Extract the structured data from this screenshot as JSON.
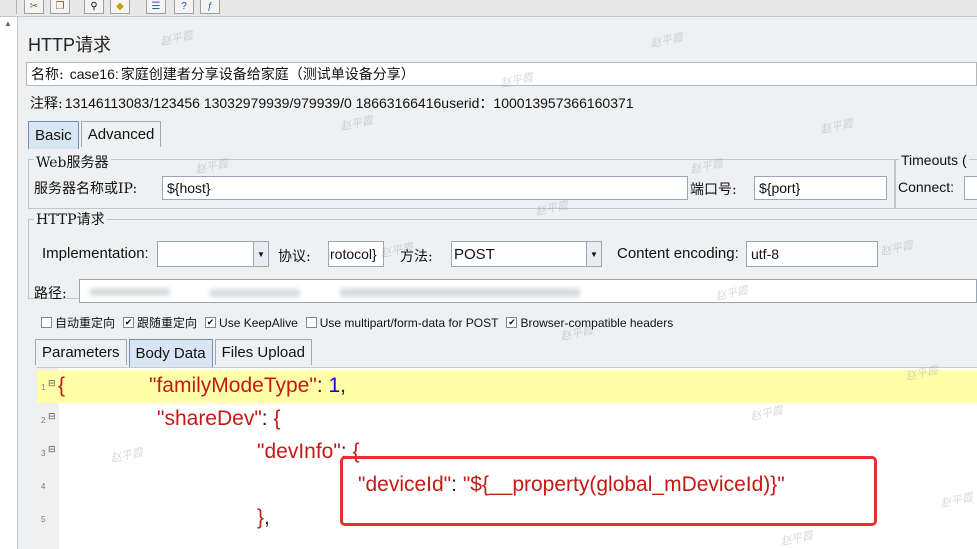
{
  "panel": {
    "title": "HTTP请求"
  },
  "name_field": {
    "label": "名称:",
    "value_prefix": "case16:",
    "value_cn": "家庭创建者分享设备给家庭（测试单设备分享）"
  },
  "comment_field": {
    "label": "注释:",
    "value": "13146113083/123456      13032979939/979939/0   18663166416userid：100013957366160371"
  },
  "main_tabs": [
    {
      "label": "Basic"
    },
    {
      "label": "Advanced"
    }
  ],
  "web_server": {
    "title": "Web服务器",
    "server_label": "服务器名称或IP:",
    "server_value": "${host}",
    "port_label": "端口号:",
    "port_value": "${port}"
  },
  "timeouts": {
    "title": "Timeouts (",
    "connect_label": "Connect:"
  },
  "http_request": {
    "title": "HTTP请求",
    "impl_label": "Implementation:",
    "impl_value": "",
    "protocol_label": "协议:",
    "protocol_value": "rotocol}",
    "method_label": "方法:",
    "method_value": "POST",
    "encoding_label": "Content encoding:",
    "encoding_value": "utf-8",
    "path_label": "路径:"
  },
  "options": [
    {
      "label": "自动重定向",
      "checked": false
    },
    {
      "label": "跟随重定向",
      "checked": true
    },
    {
      "label": "Use KeepAlive",
      "checked": true
    },
    {
      "label": "Use multipart/form-data for POST",
      "checked": false
    },
    {
      "label": "Browser-compatible headers",
      "checked": true
    }
  ],
  "body_tabs": [
    {
      "label": "Parameters"
    },
    {
      "label": "Body Data"
    },
    {
      "label": "Files Upload"
    }
  ],
  "code_lines": [
    {
      "num": "1",
      "fold": "⊟",
      "brace": "{",
      "key": "\"familyModeType\"",
      "sep": ": ",
      "val": "1",
      "tail": ","
    },
    {
      "num": "2",
      "fold": "⊟",
      "key": "\"shareDev\"",
      "sep": ": ",
      "open": "{"
    },
    {
      "num": "3",
      "fold": "⊟",
      "key": "\"devInfo\"",
      "sep": ": ",
      "open": "{"
    },
    {
      "num": "4",
      "key": "\"deviceId\"",
      "sep": ": ",
      "val": "\"${__property(global_mDeviceId)}\""
    },
    {
      "num": "5",
      "close": "}",
      "tail": ","
    }
  ],
  "watermark": "赵平霞",
  "colors": {
    "highlight_line": "#ffffaa",
    "annotation_box": "#e2342d",
    "json_key": "#c41a16",
    "active_tab": "#d8e6f3"
  }
}
